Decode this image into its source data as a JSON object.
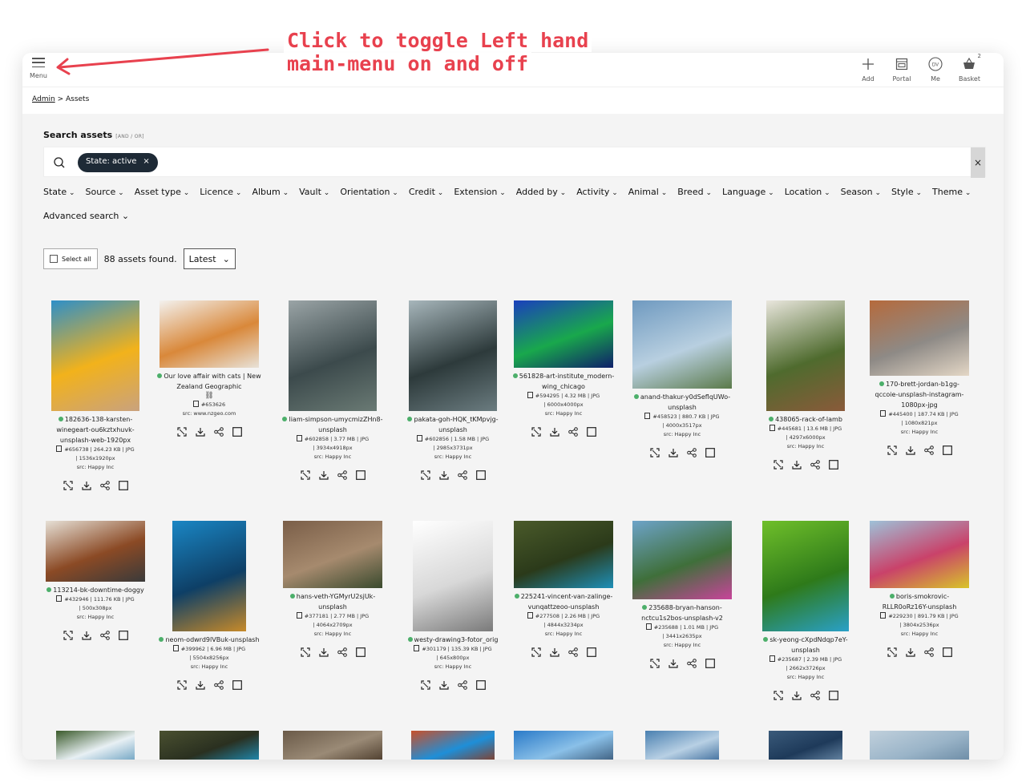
{
  "annotation": {
    "line1": "Click to toggle Left hand",
    "line2": "main-menu on and off"
  },
  "topbar": {
    "menu_label": "Menu",
    "actions": [
      {
        "label": "Add",
        "icon": "plus-icon"
      },
      {
        "label": "Portal",
        "icon": "portal-icon"
      },
      {
        "label": "Me",
        "icon": "avatar-icon",
        "initials": "DV"
      },
      {
        "label": "Basket",
        "icon": "basket-icon",
        "count": "2"
      }
    ]
  },
  "breadcrumb": {
    "root": "Admin",
    "sep": ">",
    "current": "Assets"
  },
  "search": {
    "heading": "Search assets",
    "mode": "[AND / OR]",
    "chip": "State: active",
    "chip_close": "×",
    "clear": "×"
  },
  "filters": [
    "State",
    "Source",
    "Asset type",
    "Licence",
    "Album",
    "Vault",
    "Orientation",
    "Credit",
    "Extension",
    "Added by",
    "Activity",
    "Animal",
    "Breed",
    "Language",
    "Location",
    "Season",
    "Style",
    "Theme"
  ],
  "advanced_search": "Advanced search",
  "toolbar": {
    "select_all": "Select all",
    "found": "88 assets found.",
    "sort": "Latest"
  },
  "assets": [
    {
      "name": "182636-138-karsten-winegeart-ou6kztxhuvk-unsplash-web-1920px",
      "lines": [
        "182636-138-karsten-",
        "winegeart-ou6kztxhuvk-",
        "unsplash-web-1920px"
      ],
      "meta": [
        "#656738 | 264.23 KB | JPG",
        "| 1536x1920px"
      ],
      "src": "src: Happy Inc",
      "colors": [
        "#2e8fc8",
        "#f2b21b",
        "#c9a27e"
      ]
    },
    {
      "name": "Our love affair with cats | New Zealand Geographic",
      "lines": [
        "Our love affair with cats | New",
        "Zealand Geographic"
      ],
      "meta": [
        "#653626"
      ],
      "src": "src: www.nzgeo.com",
      "link": true,
      "colors": [
        "#f3f1ee",
        "#d9883a",
        "#e8e2d8"
      ]
    },
    {
      "name": "liam-simpson-umycmizZHn8-unsplash",
      "lines": [
        "liam-simpson-umycmizZHn8-",
        "unsplash"
      ],
      "meta": [
        "#602858 | 3.77 MB | JPG",
        "| 3934x4918px"
      ],
      "src": "src: Happy Inc",
      "colors": [
        "#9aa4a6",
        "#3c4a4c",
        "#6a7a74"
      ]
    },
    {
      "name": "pakata-goh-HQK_tKMpvjg-unsplash",
      "lines": [
        "pakata-goh-HQK_tKMpvjg-",
        "unsplash"
      ],
      "meta": [
        "#602856 | 1.58 MB | JPG",
        "| 2985x3731px"
      ],
      "src": "src: Happy Inc",
      "colors": [
        "#a7b6bb",
        "#2d3a3b",
        "#6b7c80"
      ]
    },
    {
      "name": "561828-art-institute_modern-wing_chicago",
      "lines": [
        "561828-art-institute_modern-",
        "wing_chicago"
      ],
      "meta": [
        "#594295 | 4.32 MB | JPG",
        "| 6000x4000px"
      ],
      "src": "src: Happy Inc",
      "colors": [
        "#1a3fbd",
        "#19a84c",
        "#0f1f6a"
      ]
    },
    {
      "name": "anand-thakur-y0dSeflqUWo-unsplash",
      "lines": [
        "anand-thakur-y0dSeflqUWo-",
        "unsplash"
      ],
      "meta": [
        "#458523 | 880.7 KB | JPG",
        "| 4000x3517px"
      ],
      "src": "src: Happy Inc",
      "colors": [
        "#6f9ac0",
        "#b8cfe0",
        "#5b7a4a"
      ]
    },
    {
      "name": "438065-rack-of-lamb",
      "lines": [
        "438065-rack-of-lamb"
      ],
      "meta": [
        "#445681 | 13.6 MB | JPG",
        "| 4297x6000px"
      ],
      "src": "src: Happy Inc",
      "colors": [
        "#e9e6dd",
        "#4f6b2e",
        "#8a5a3a"
      ]
    },
    {
      "name": "170-brett-jordan-b1gg-qccoie-unsplash-instagram-1080px-jpg",
      "lines": [
        "170-brett-jordan-b1gg-",
        "qccoie-unsplash-instagram-",
        "1080px-jpg"
      ],
      "meta": [
        "#445400 | 187.74 KB | JPG",
        "| 1080x821px"
      ],
      "src": "src: Happy Inc",
      "colors": [
        "#b56a3c",
        "#8e8a86",
        "#e4d7c6"
      ]
    },
    {
      "name": "113214-bk-downtime-doggy",
      "lines": [
        "113214-bk-downtime-doggy"
      ],
      "meta": [
        "#432946 | 111.76 KB | JPG",
        "| 500x308px"
      ],
      "src": "src: Happy Inc",
      "colors": [
        "#e6e0d6",
        "#8b4a25",
        "#3a3a3a"
      ]
    },
    {
      "name": "neom-odwrd9lVBuk-unsplash",
      "lines": [
        "neom-odwrd9lVBuk-unsplash"
      ],
      "meta": [
        "#399962 | 6.96 MB | JPG",
        "| 5504x8256px"
      ],
      "src": "src: Happy Inc",
      "colors": [
        "#1a86c4",
        "#0e3f66",
        "#c78a2a"
      ]
    },
    {
      "name": "hans-veth-YGMyrU2sjUk-unsplash",
      "lines": [
        "hans-veth-YGMyrU2sjUk-",
        "unsplash"
      ],
      "meta": [
        "#377181 | 2.77 MB | JPG",
        "| 4064x2709px"
      ],
      "src": "src: Happy Inc",
      "colors": [
        "#7a5e48",
        "#a68a6e",
        "#3a4a2e"
      ]
    },
    {
      "name": "westy-drawing3-fotor_orig",
      "lines": [
        "westy-drawing3-fotor_orig"
      ],
      "meta": [
        "#301179 | 135.39 KB | JPG",
        "| 645x800px"
      ],
      "src": "src: Happy Inc",
      "colors": [
        "#ffffff",
        "#d8d8d8",
        "#7a7a7a"
      ]
    },
    {
      "name": "225241-vincent-van-zalinge-vunqattzeoo-unsplash",
      "lines": [
        "225241-vincent-van-zalinge-",
        "vunqattzeoo-unsplash"
      ],
      "meta": [
        "#277508 | 2.26 MB | JPG",
        "| 4844x3234px"
      ],
      "src": "src: Happy Inc",
      "colors": [
        "#4a5a2a",
        "#2b3a1a",
        "#1e8fb8"
      ]
    },
    {
      "name": "235688-bryan-hanson-nctcu1s2bos-unsplash-v2",
      "lines": [
        "235688-bryan-hanson-",
        "nctcu1s2bos-unsplash-v2"
      ],
      "meta": [
        "#235688 | 1.01 MB | JPG",
        "| 3441x2635px"
      ],
      "src": "src: Happy Inc",
      "colors": [
        "#6da3c8",
        "#3f6f3a",
        "#c8449a"
      ]
    },
    {
      "name": "sk-yeong-cXpdNdqp7eY-unsplash",
      "lines": [
        "sk-yeong-cXpdNdqp7eY-",
        "unsplash"
      ],
      "meta": [
        "#235687 | 2.39 MB | JPG",
        "| 2662x3726px"
      ],
      "src": "src: Happy Inc",
      "colors": [
        "#6fbf2a",
        "#2e7a1a",
        "#2aa0c8"
      ]
    },
    {
      "name": "boris-smokrovic-RLLR0oRz16Y-unsplash",
      "lines": [
        "boris-smokrovic-",
        "RLLR0oRz16Y-unsplash"
      ],
      "meta": [
        "#229230 | 891.79 KB | JPG",
        "| 3804x2536px"
      ],
      "src": "src: Happy Inc",
      "colors": [
        "#9ec1d8",
        "#c9426a",
        "#d8c42a"
      ]
    },
    {
      "name": "",
      "lines": [],
      "meta": [],
      "src": "",
      "colors": [
        "#3a5a2a",
        "#e8f0f4",
        "#6aa0c0"
      ]
    },
    {
      "name": "",
      "lines": [],
      "meta": [],
      "src": "",
      "colors": [
        "#4a5030",
        "#2a3020",
        "#1e8fb8"
      ]
    },
    {
      "name": "",
      "lines": [],
      "meta": [],
      "src": "",
      "colors": [
        "#6a5a48",
        "#9a8a76",
        "#4a3a2a"
      ]
    },
    {
      "name": "",
      "lines": [],
      "meta": [],
      "src": "",
      "colors": [
        "#c8502a",
        "#1e8fd8",
        "#8a3a20"
      ]
    },
    {
      "name": "",
      "lines": [],
      "meta": [],
      "src": "",
      "colors": [
        "#2a7ac8",
        "#8ac0e8",
        "#3a5a7a"
      ]
    },
    {
      "name": "",
      "lines": [],
      "meta": [],
      "src": "",
      "colors": [
        "#4a80b0",
        "#b8d0e4",
        "#3a6a9a"
      ]
    },
    {
      "name": "",
      "lines": [],
      "meta": [],
      "src": "",
      "colors": [
        "#3a5a7a",
        "#1e3a5a",
        "#6a8aa8"
      ]
    },
    {
      "name": "",
      "lines": [],
      "meta": [],
      "src": "",
      "colors": [
        "#c0d0dc",
        "#9ab4c8",
        "#6a8aa4"
      ]
    }
  ]
}
